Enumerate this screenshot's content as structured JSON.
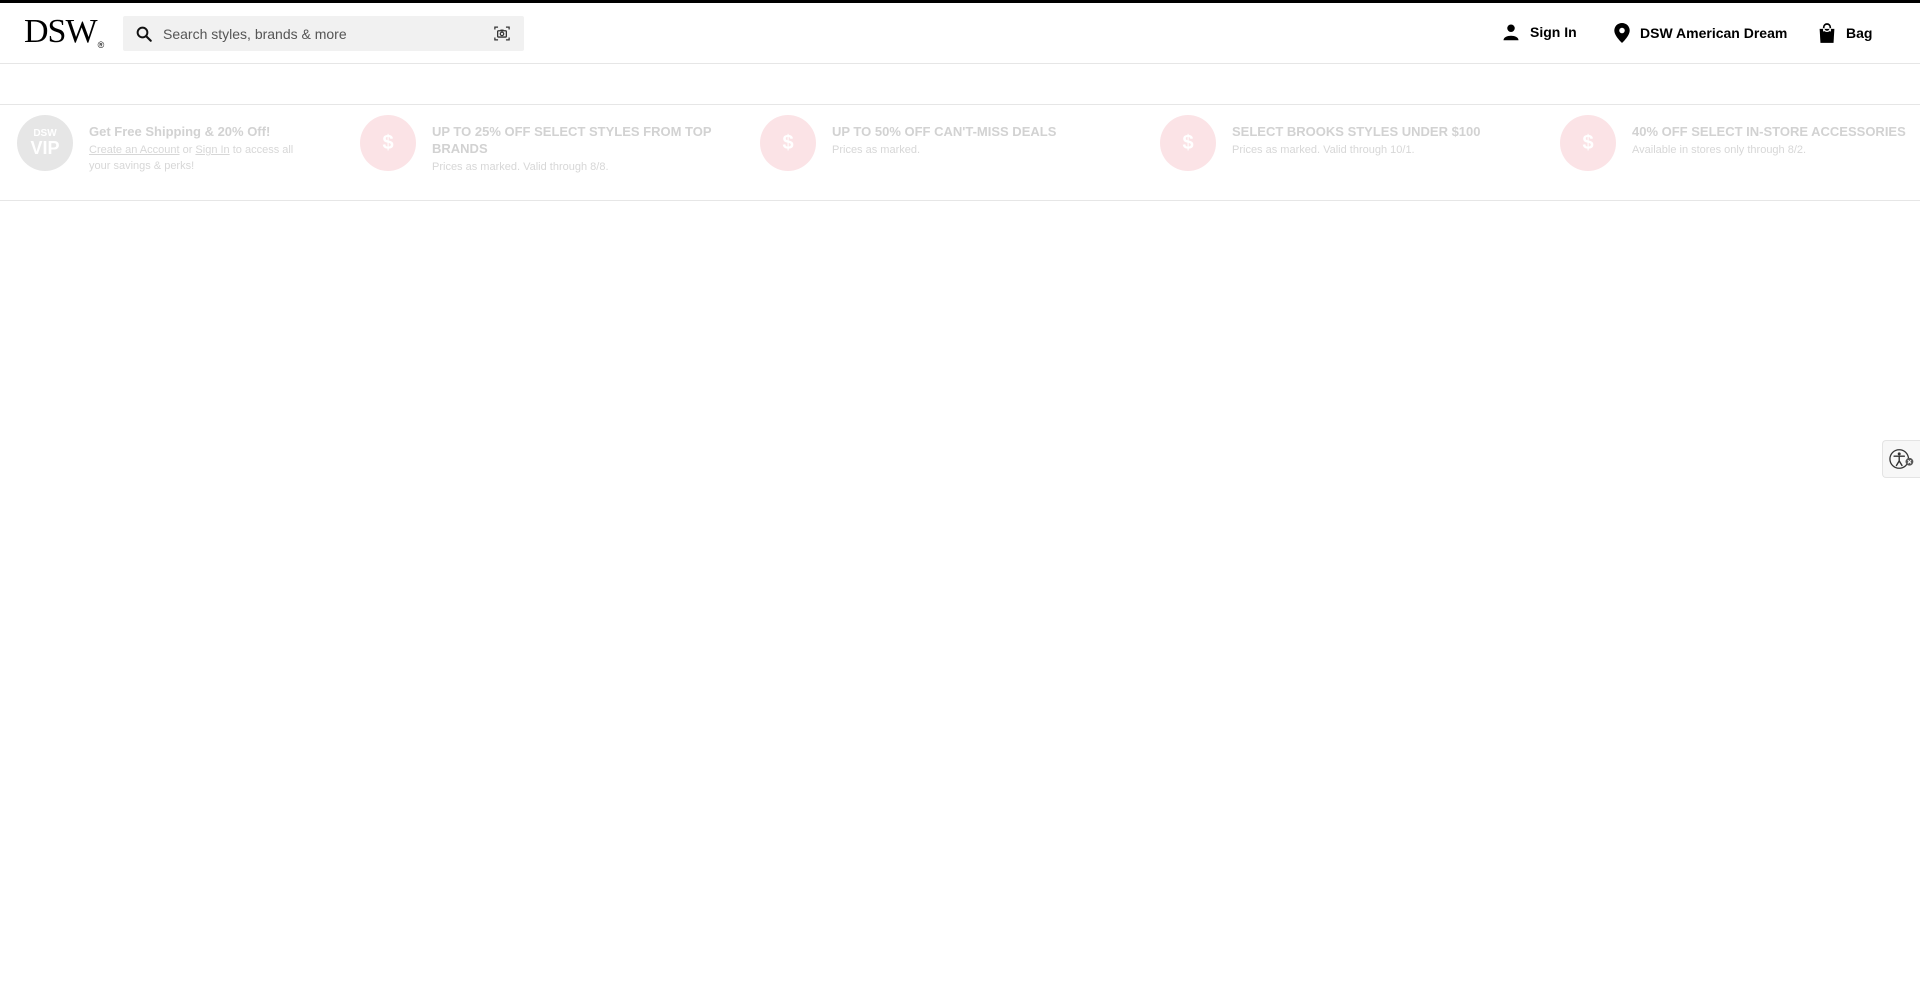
{
  "brand": {
    "logo_text": "DSW",
    "logo_mark": "®"
  },
  "search": {
    "placeholder": "Search styles, brands & more"
  },
  "nav": {
    "sign_in": "Sign In",
    "store": "DSW American Dream",
    "bag": "Bag"
  },
  "promos": [
    {
      "badge": "vip",
      "badge_top": "DSW",
      "badge_bottom": "VIP",
      "title": "Get Free Shipping & 20% Off!",
      "sub_link1": "Create an Account",
      "sub_or": " or ",
      "sub_link2": "Sign In",
      "sub_rest": " to access all your savings & perks!"
    },
    {
      "badge": "$",
      "title": "UP TO 25% OFF SELECT STYLES FROM TOP BRANDS",
      "sub": "Prices as marked. Valid through 8/8."
    },
    {
      "badge": "$",
      "title": "UP TO 50% OFF CAN'T-MISS DEALS",
      "sub": "Prices as marked."
    },
    {
      "badge": "$",
      "title": "SELECT BROOKS STYLES UNDER $100",
      "sub": "Prices as marked. Valid through 10/1."
    },
    {
      "badge": "$",
      "title": "40% OFF SELECT IN-STORE ACCESSORIES",
      "sub": "Available in stores only through 8/2."
    }
  ],
  "colors": {
    "accent": "#000000",
    "promo_badge": "#fbe3e6",
    "vip_badge": "#e6e6e6"
  },
  "icons": {
    "search": "search-icon",
    "camera": "camera-search-icon",
    "account": "person-icon",
    "store": "location-pin-icon",
    "bag": "shopping-bag-icon",
    "accessibility": "accessibility-icon"
  }
}
